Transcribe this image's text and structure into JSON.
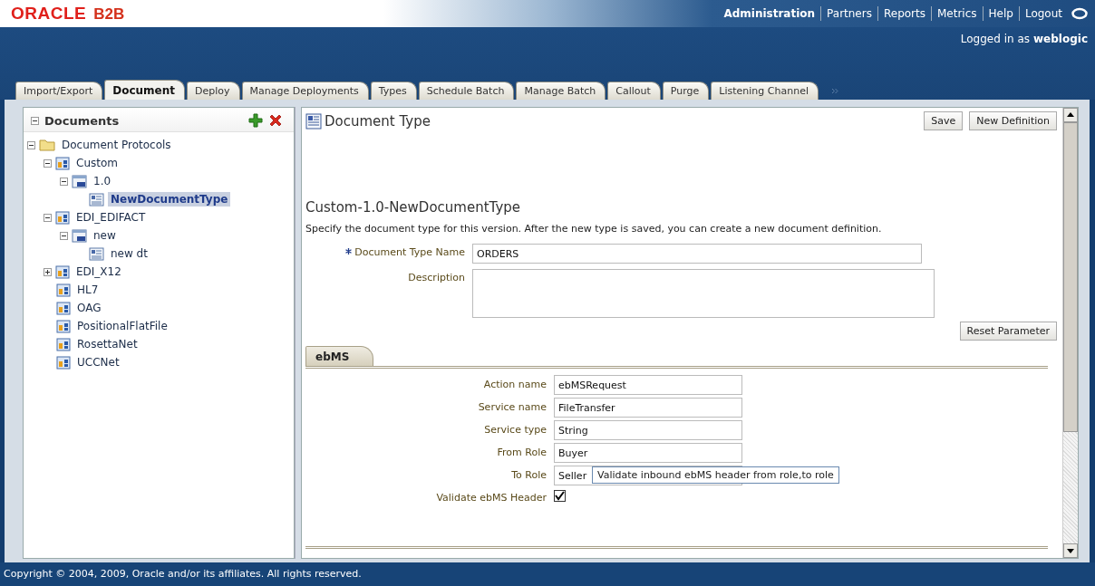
{
  "header": {
    "logo": "ORACLE",
    "product": "B2B",
    "nav": [
      {
        "label": "Administration",
        "selected": true
      },
      {
        "label": "Partners",
        "selected": false
      },
      {
        "label": "Reports",
        "selected": false
      },
      {
        "label": "Metrics",
        "selected": false
      },
      {
        "label": "Help",
        "selected": false
      },
      {
        "label": "Logout",
        "selected": false
      }
    ],
    "login_prefix": "Logged in as",
    "login_user": "weblogic"
  },
  "tabs": [
    {
      "label": "Import/Export",
      "selected": false
    },
    {
      "label": "Document",
      "selected": true
    },
    {
      "label": "Deploy",
      "selected": false
    },
    {
      "label": "Manage Deployments",
      "selected": false
    },
    {
      "label": "Types",
      "selected": false
    },
    {
      "label": "Schedule Batch",
      "selected": false
    },
    {
      "label": "Manage Batch",
      "selected": false
    },
    {
      "label": "Callout",
      "selected": false
    },
    {
      "label": "Purge",
      "selected": false
    },
    {
      "label": "Listening Channel",
      "selected": false
    }
  ],
  "sidebar": {
    "title": "Documents",
    "expanded": true,
    "tree": [
      {
        "label": "Document Protocols",
        "kind": "folder",
        "expanded": true,
        "selected": false,
        "children": [
          {
            "label": "Custom",
            "kind": "protocol",
            "expanded": true,
            "selected": false,
            "children": [
              {
                "label": "1.0",
                "kind": "version",
                "expanded": true,
                "selected": false,
                "children": [
                  {
                    "label": "NewDocumentType",
                    "kind": "doctype",
                    "selected": true
                  }
                ]
              }
            ]
          },
          {
            "label": "EDI_EDIFACT",
            "kind": "protocol",
            "expanded": true,
            "selected": false,
            "children": [
              {
                "label": "new",
                "kind": "version",
                "expanded": true,
                "selected": false,
                "children": [
                  {
                    "label": "new dt",
                    "kind": "doctype",
                    "selected": false
                  }
                ]
              }
            ]
          },
          {
            "label": "EDI_X12",
            "kind": "protocol",
            "expanded": false,
            "selected": false
          },
          {
            "label": "HL7",
            "kind": "protocol",
            "selected": false
          },
          {
            "label": "OAG",
            "kind": "protocol",
            "selected": false
          },
          {
            "label": "PositionalFlatFile",
            "kind": "protocol",
            "selected": false
          },
          {
            "label": "RosettaNet",
            "kind": "protocol",
            "selected": false
          },
          {
            "label": "UCCNet",
            "kind": "protocol",
            "selected": false
          }
        ]
      }
    ]
  },
  "main": {
    "title": "Document Type",
    "buttons": [
      "Save",
      "New Definition"
    ],
    "subtitle": "Custom-1.0-NewDocumentType",
    "instructions": "Specify the document type for this version. After the new type is saved, you can create a new document definition.",
    "fields": [
      {
        "label": "Document Type Name",
        "required": true,
        "kind": "text",
        "value": "ORDERS"
      },
      {
        "label": "Description",
        "required": false,
        "kind": "textarea"
      }
    ],
    "reset_button": "Reset Parameter",
    "section_tab": "ebMS",
    "section_fields": [
      {
        "label": "Action name",
        "kind": "text",
        "value": "ebMSRequest"
      },
      {
        "label": "Service name",
        "kind": "text",
        "value": "FileTransfer"
      },
      {
        "label": "Service type",
        "kind": "text",
        "value": "String"
      },
      {
        "label": "From Role",
        "kind": "text",
        "value": "Buyer"
      },
      {
        "label": "To Role",
        "kind": "text",
        "value": "Seller"
      },
      {
        "label": "Validate ebMS Header",
        "kind": "checkbox",
        "checked": true
      }
    ],
    "tooltip": "Validate inbound ebMS header from role,to role"
  },
  "footer": "Copyright © 2004, 2009, Oracle and/or its affiliates. All rights reserved."
}
